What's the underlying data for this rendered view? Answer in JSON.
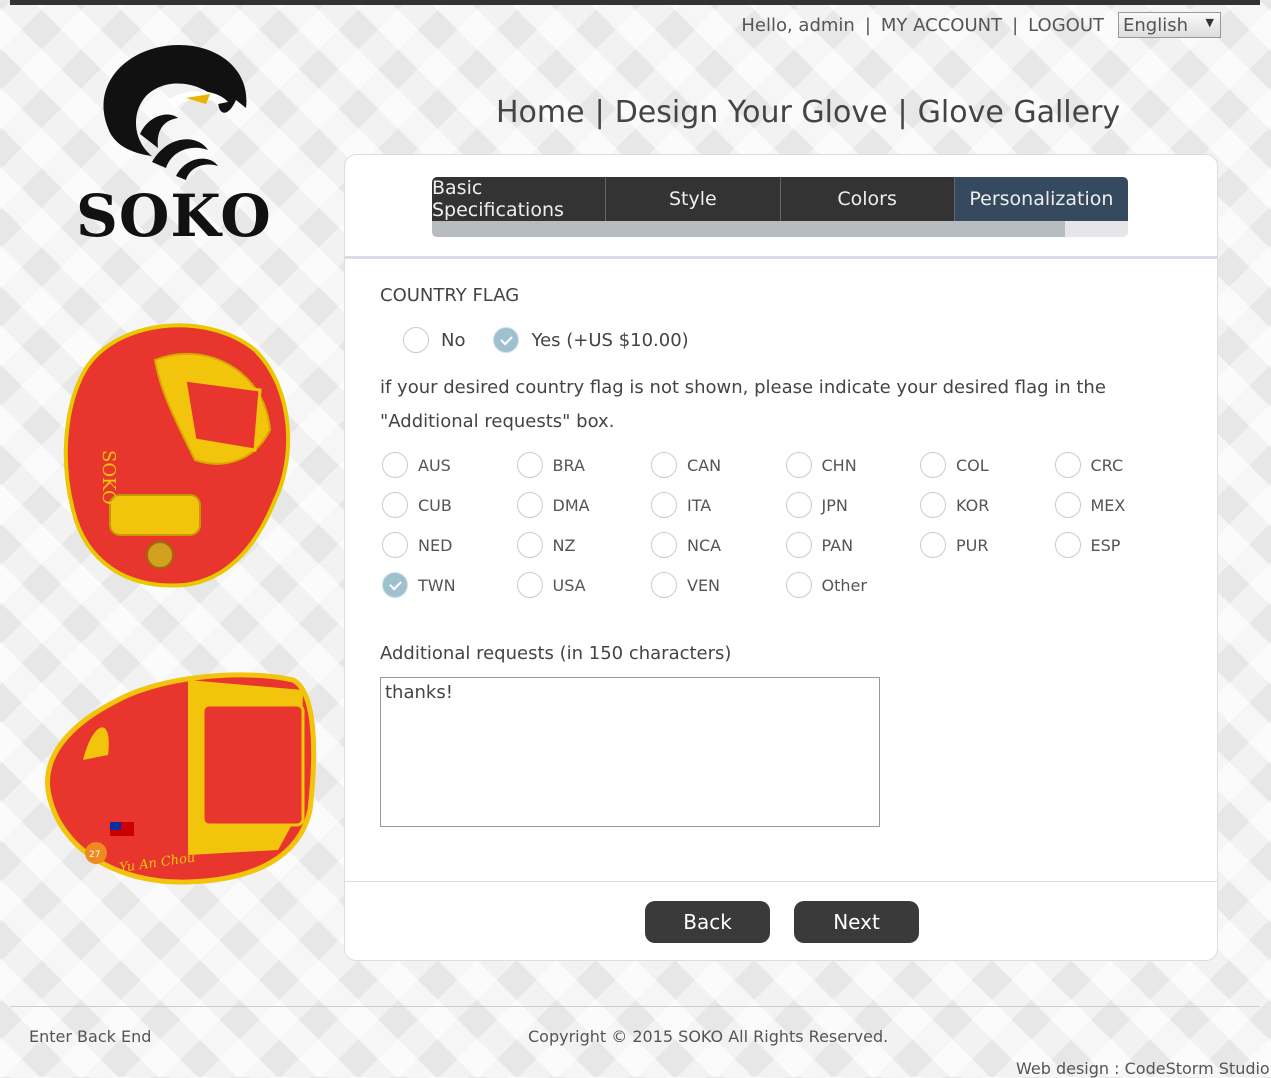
{
  "header": {
    "greeting": "Hello, admin",
    "my_account": "MY ACCOUNT",
    "logout": "LOGOUT",
    "language": "English"
  },
  "logo": {
    "text": "SOKO"
  },
  "nav": {
    "home": "Home",
    "design": "Design Your Glove",
    "gallery": "Glove Gallery"
  },
  "tabs": [
    "Basic Specifications",
    "Style",
    "Colors",
    "Personalization"
  ],
  "progress": 0.91,
  "country_flag": {
    "title": "COUNTRY FLAG",
    "no_label": "No",
    "yes_label": "Yes (+US $10.00)",
    "selected": "yes",
    "note": "if your desired country flag is not shown, please indicate your desired flag in the \"Additional requests\" box.",
    "flags": [
      "AUS",
      "BRA",
      "CAN",
      "CHN",
      "COL",
      "CRC",
      "CUB",
      "DMA",
      "ITA",
      "JPN",
      "KOR",
      "MEX",
      "NED",
      "NZ",
      "NCA",
      "PAN",
      "PUR",
      "ESP",
      "TWN",
      "USA",
      "VEN",
      "Other"
    ],
    "selected_flag": "TWN"
  },
  "additional": {
    "label": "Additional requests (in 150 characters)",
    "value": "thanks!"
  },
  "buttons": {
    "back": "Back",
    "next": "Next"
  },
  "glove2": {
    "name_text": "Yu An Chou",
    "number": "27"
  },
  "footer": {
    "backend": "Enter Back End",
    "copyright": "Copyright © 2015 SOKO All Rights Reserved.",
    "credit": "Web design : CodeStorm Studio"
  }
}
